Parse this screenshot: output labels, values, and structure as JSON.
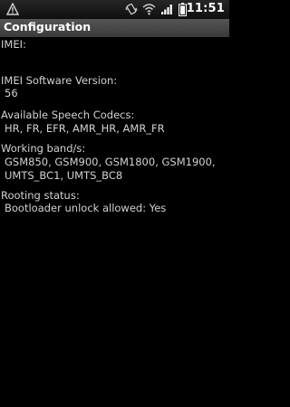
{
  "status_bar": {
    "time": "11:51",
    "icons": [
      "warning-icon",
      "vibrate-icon",
      "wifi-icon",
      "signal-icon",
      "battery-icon"
    ]
  },
  "title_bar": {
    "title": "Configuration"
  },
  "fields": {
    "imei": {
      "label": "IMEI:",
      "value": ""
    },
    "imei_sv": {
      "label": "IMEI Software Version:",
      "value": "56"
    },
    "codecs": {
      "label": "Available Speech Codecs:",
      "value": "HR, FR, EFR, AMR_HR, AMR_FR"
    },
    "bands": {
      "label": "Working band/s:",
      "value": "GSM850, GSM900, GSM1800, GSM1900,\nUMTS_BC1, UMTS_BC8"
    },
    "rooting": {
      "label": "Rooting status:",
      "value": "Bootloader unlock allowed: Yes"
    }
  },
  "colors": {
    "background": "#000000",
    "text": "#d2d2d2",
    "title_bar": "#4a4a4a"
  }
}
